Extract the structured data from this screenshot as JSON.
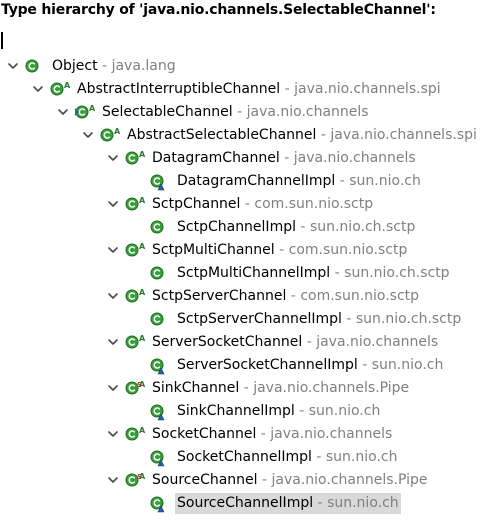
{
  "header": {
    "title": "Type hierarchy of 'java.nio.channels.SelectableChannel':"
  },
  "filter": {
    "value": ""
  },
  "separator": " - ",
  "tree": [
    {
      "name": "Object",
      "package": "java.lang",
      "depth": 0,
      "expandable": true,
      "kind": "class"
    },
    {
      "name": "AbstractInterruptibleChannel",
      "package": "java.nio.channels.spi",
      "depth": 1,
      "expandable": true,
      "kind": "abstract-class"
    },
    {
      "name": "SelectableChannel",
      "package": "java.nio.channels",
      "depth": 2,
      "expandable": true,
      "kind": "focus-abstract-class"
    },
    {
      "name": "AbstractSelectableChannel",
      "package": "java.nio.channels.spi",
      "depth": 3,
      "expandable": true,
      "kind": "abstract-class"
    },
    {
      "name": "DatagramChannel",
      "package": "java.nio.channels",
      "depth": 4,
      "expandable": true,
      "kind": "abstract-class"
    },
    {
      "name": "DatagramChannelImpl",
      "package": "sun.nio.ch",
      "depth": 5,
      "expandable": false,
      "kind": "class-impl"
    },
    {
      "name": "SctpChannel",
      "package": "com.sun.nio.sctp",
      "depth": 4,
      "expandable": true,
      "kind": "abstract-class"
    },
    {
      "name": "SctpChannelImpl",
      "package": "sun.nio.ch.sctp",
      "depth": 5,
      "expandable": false,
      "kind": "class"
    },
    {
      "name": "SctpMultiChannel",
      "package": "com.sun.nio.sctp",
      "depth": 4,
      "expandable": true,
      "kind": "abstract-class"
    },
    {
      "name": "SctpMultiChannelImpl",
      "package": "sun.nio.ch.sctp",
      "depth": 5,
      "expandable": false,
      "kind": "class"
    },
    {
      "name": "SctpServerChannel",
      "package": "com.sun.nio.sctp",
      "depth": 4,
      "expandable": true,
      "kind": "abstract-class"
    },
    {
      "name": "SctpServerChannelImpl",
      "package": "sun.nio.ch.sctp",
      "depth": 5,
      "expandable": false,
      "kind": "class"
    },
    {
      "name": "ServerSocketChannel",
      "package": "java.nio.channels",
      "depth": 4,
      "expandable": true,
      "kind": "abstract-class"
    },
    {
      "name": "ServerSocketChannelImpl",
      "package": "sun.nio.ch",
      "depth": 5,
      "expandable": false,
      "kind": "class-impl"
    },
    {
      "name": "SinkChannel",
      "package": "java.nio.channels.Pipe",
      "depth": 4,
      "expandable": true,
      "kind": "static-abstract-class"
    },
    {
      "name": "SinkChannelImpl",
      "package": "sun.nio.ch",
      "depth": 5,
      "expandable": false,
      "kind": "class-impl"
    },
    {
      "name": "SocketChannel",
      "package": "java.nio.channels",
      "depth": 4,
      "expandable": true,
      "kind": "abstract-class"
    },
    {
      "name": "SocketChannelImpl",
      "package": "sun.nio.ch",
      "depth": 5,
      "expandable": false,
      "kind": "class-impl"
    },
    {
      "name": "SourceChannel",
      "package": "java.nio.channels.Pipe",
      "depth": 4,
      "expandable": true,
      "kind": "static-abstract-class"
    },
    {
      "name": "SourceChannelImpl",
      "package": "sun.nio.ch",
      "depth": 5,
      "expandable": false,
      "kind": "class-impl",
      "selected": true
    }
  ],
  "colors": {
    "class_icon_fill": "#3a9f3a",
    "class_icon_border": "#1e6e1e",
    "abstract_marker": "#2a7a2a",
    "impl_marker": "#2b5fa8",
    "twistie": "#4a4a4a",
    "package_text": "#808080",
    "selection": "#d9d9d9"
  }
}
